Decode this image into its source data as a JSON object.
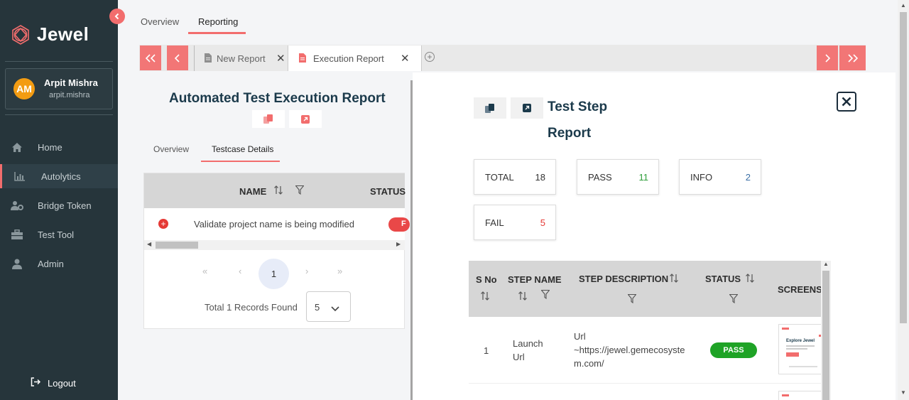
{
  "app": {
    "name": "Jewel"
  },
  "user": {
    "initials": "AM",
    "name": "Arpit Mishra",
    "handle": "arpit.mishra"
  },
  "sidebar": {
    "items": [
      {
        "label": "Home",
        "icon": "home-icon"
      },
      {
        "label": "Autolytics",
        "icon": "bar-chart-icon",
        "active": true
      },
      {
        "label": "Bridge Token",
        "icon": "users-gear-icon"
      },
      {
        "label": "Test Tool",
        "icon": "toolbox-icon"
      },
      {
        "label": "Admin",
        "icon": "user-icon"
      }
    ],
    "logout": "Logout"
  },
  "top_tabs": [
    {
      "label": "Overview"
    },
    {
      "label": "Reporting",
      "active": true
    }
  ],
  "doc_tabs": [
    {
      "label": "New Report"
    },
    {
      "label": "Execution Report",
      "active": true
    }
  ],
  "left": {
    "title": "Automated Test Execution Report",
    "sub_tabs": [
      {
        "label": "Overview"
      },
      {
        "label": "Testcase Details",
        "active": true
      }
    ],
    "table": {
      "headers": {
        "name": "NAME",
        "status": "STATUS"
      },
      "rows": [
        {
          "name": "Validate project name is being modified",
          "status": "F"
        }
      ]
    },
    "pager": {
      "first": "«",
      "prev": "‹",
      "current": "1",
      "next": "›",
      "last": "»"
    },
    "records": "Total 1 Records Found",
    "page_size": "5"
  },
  "right": {
    "title_line1": "Test Step",
    "title_line2": "Report",
    "stats": [
      {
        "label": "TOTAL",
        "value": "18",
        "color": "#333333"
      },
      {
        "label": "PASS",
        "value": "11",
        "color": "#2e9e3a"
      },
      {
        "label": "INFO",
        "value": "2",
        "color": "#3a6ea5"
      },
      {
        "label": "FAIL",
        "value": "5",
        "color": "#e53935"
      }
    ],
    "table": {
      "headers": {
        "sno_a": "S No",
        "step_name": "STEP NAME",
        "step_desc": "STEP DESCRIPTION",
        "status": "STATUS",
        "screenshot": "SCREENSH"
      },
      "rows": [
        {
          "sno": "1",
          "step_name_a": "Launch",
          "step_name_b": "Url",
          "desc_a": "Url",
          "desc_b": "~https://jewel.gemecosyste",
          "desc_c": "m.com/",
          "status": "PASS"
        }
      ]
    },
    "screenshot_thumb": {
      "title": "Explore Jewel"
    }
  },
  "colors": {
    "accent": "#f26d6d",
    "sidebar_bg": "#26353b",
    "heading": "#1b3a4b",
    "pass": "#1fa326",
    "fail": "#e94848"
  }
}
